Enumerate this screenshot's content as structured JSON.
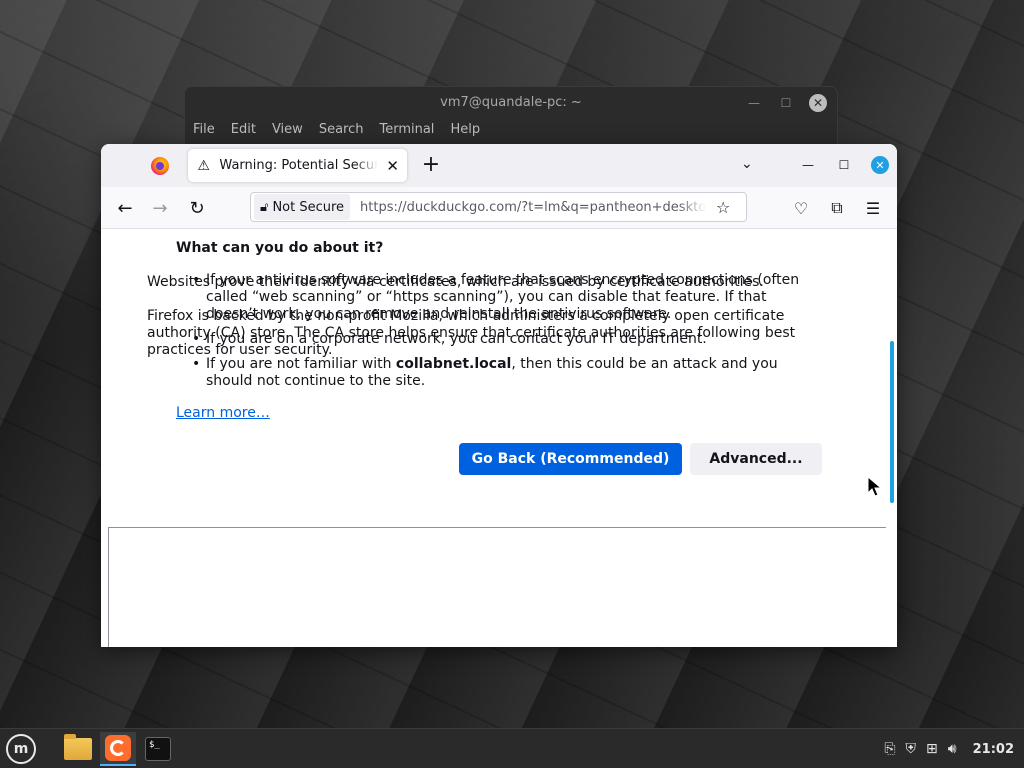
{
  "terminal": {
    "title": "vm7@quandale-pc: ~",
    "menu": [
      "File",
      "Edit",
      "View",
      "Search",
      "Terminal",
      "Help"
    ]
  },
  "browser": {
    "tab_title": "Warning: Potential Security Risk Ahead",
    "new_tab_symbol": "+",
    "url_security_label": "Not Secure",
    "url": "https://duckduckgo.com/?t=lm&q=pantheon+desktop+environment",
    "accent_color": "#0061e0"
  },
  "page": {
    "heading": "What can you do about it?",
    "bullets": [
      "If your antivirus software includes a feature that scans encrypted connections (often called “web scanning” or “https scanning”), you can disable that feature. If that doesn’t work, you can remove and reinstall the antivirus software.",
      "If you are on a corporate network, you can contact your IT department."
    ],
    "bullet3_prefix": "If you are not familiar with ",
    "bullet3_domain": "collabnet.local",
    "bullet3_suffix": ", then this could be an attack and you should not continue to the site.",
    "learn_more": "Learn more…",
    "go_back_button": "Go Back (Recommended)",
    "advanced_button": "Advanced...",
    "advanced_p1": "Websites prove their identity via certificates, which are issued by certificate authorities.",
    "advanced_p2": "Firefox is backed by the non-profit Mozilla, which administers a completely open certificate authority (CA) store. The CA store helps ensure that certificate authorities are following best practices for user security."
  },
  "taskbar": {
    "clock": "21:02",
    "apps": [
      "files-icon",
      "firefox-icon",
      "terminal-icon"
    ]
  }
}
